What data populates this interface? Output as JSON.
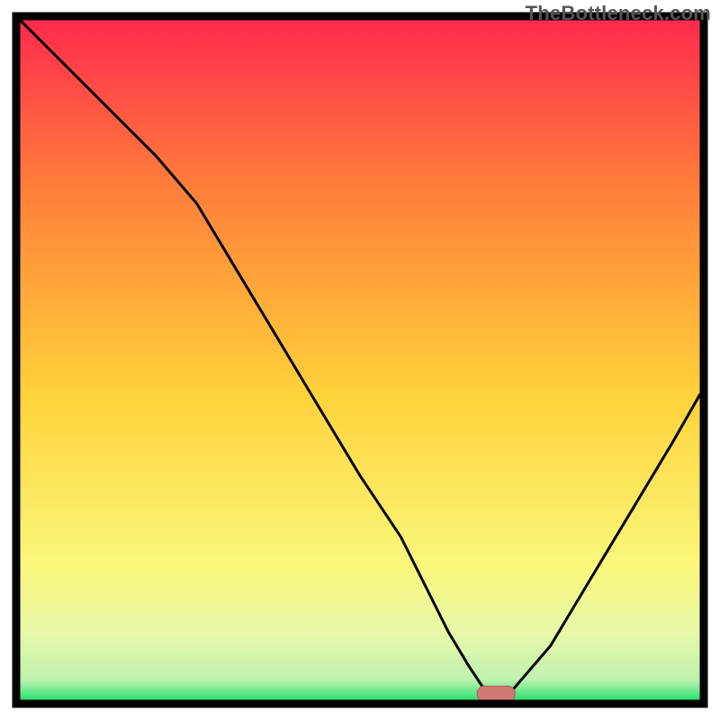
{
  "watermark": "TheBottleneck.com",
  "colors": {
    "frame": "#000000",
    "curve": "#000000",
    "marker_fill": "#cf7a76",
    "marker_stroke": "#b45a55",
    "grad_top": "#ff2a4d",
    "grad_mid_upper": "#ff7f3a",
    "grad_mid": "#ffd23a",
    "grad_lower": "#faf77a",
    "grad_pale": "#e8f8a8",
    "grad_green": "#29e06e"
  },
  "chart_data": {
    "type": "line",
    "title": "",
    "xlabel": "",
    "ylabel": "",
    "xlim": [
      0,
      100
    ],
    "ylim": [
      0,
      100
    ],
    "grid": false,
    "legend": false,
    "series": [
      {
        "name": "bottleneck-curve",
        "x": [
          0,
          10,
          20,
          26,
          32,
          38,
          44,
          50,
          56,
          60,
          63,
          66,
          68,
          72,
          78,
          84,
          90,
          96,
          100
        ],
        "values": [
          100,
          90,
          80,
          73,
          63,
          53,
          43,
          33,
          24,
          16,
          10,
          5,
          2,
          1,
          8,
          18,
          28,
          38,
          45
        ]
      }
    ],
    "optimum_marker": {
      "x": 70,
      "y": 1
    },
    "gradient_stops": [
      {
        "offset": 0.0,
        "color": "#ff2a4d"
      },
      {
        "offset": 0.25,
        "color": "#ff7f3a"
      },
      {
        "offset": 0.55,
        "color": "#ffd23a"
      },
      {
        "offset": 0.8,
        "color": "#faf77a"
      },
      {
        "offset": 0.9,
        "color": "#e8f8a8"
      },
      {
        "offset": 0.97,
        "color": "#bff2b0"
      },
      {
        "offset": 1.0,
        "color": "#29e06e"
      }
    ]
  }
}
